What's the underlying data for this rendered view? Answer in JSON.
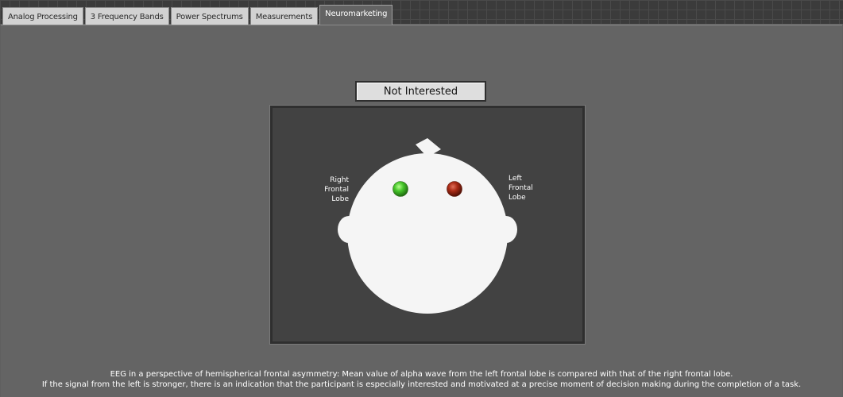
{
  "tabs": [
    {
      "label": "Analog Processing",
      "active": false
    },
    {
      "label": "3 Frequency Bands",
      "active": false
    },
    {
      "label": "Power Spectrums",
      "active": false
    },
    {
      "label": "Measurements",
      "active": false
    },
    {
      "label": "Neuromarketing",
      "active": true
    }
  ],
  "status": {
    "label": "Not Interested"
  },
  "head": {
    "right_lobe_label": "Right Frontal Lobe",
    "left_lobe_label": "Left Frontal Lobe",
    "right_led": {
      "state": "on",
      "color": "#46c62a"
    },
    "left_led": {
      "state": "off",
      "color": "#a82a15"
    },
    "head_color": "#f5f5f5",
    "background_color": "#424242"
  },
  "description": {
    "line1": "EEG in a perspective of hemispherical frontal asymmetry: Mean value of alpha wave from the left frontal lobe is compared with that of the right frontal lobe.",
    "line2": "If the signal from the left is stronger, there is an indication that the participant is especially interested and motivated at a precise moment of decision making during the completion of a task."
  }
}
